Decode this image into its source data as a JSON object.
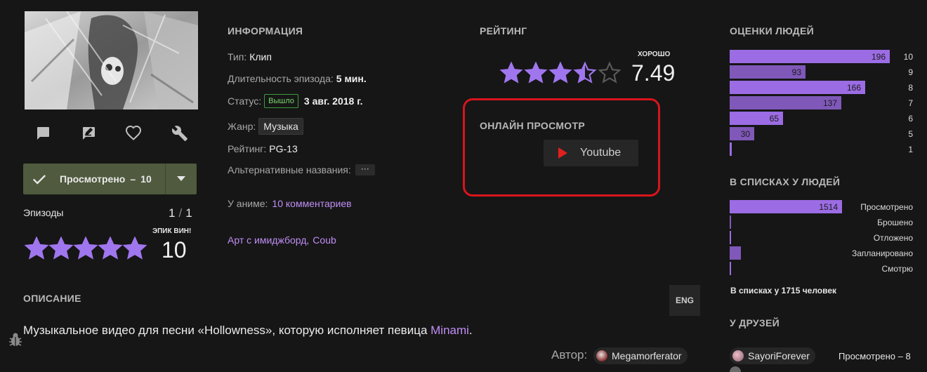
{
  "actions": {
    "comment_icon": "comment-icon",
    "review_icon": "review-icon",
    "favorite_icon": "heart-icon",
    "edit_icon": "wrench-icon"
  },
  "user_rate": {
    "status_label": "Просмотрено",
    "separator": "–",
    "score": "10",
    "episodes_label": "Эпизоды",
    "episodes_watched": "1",
    "episodes_sep": "/",
    "episodes_total": "1",
    "score_caption": "ЭПИК ВИН!",
    "score_big": "10",
    "stars": 5
  },
  "info": {
    "heading": "ИНФОРМАЦИЯ",
    "type_label": "Тип:",
    "type_value": "Клип",
    "duration_label": "Длительность эпизода:",
    "duration_value": "5 мин.",
    "status_label": "Статус:",
    "status_badge": "Вышло",
    "status_date": "3 авг. 2018 г.",
    "genre_label": "Жанр:",
    "genre_value": "Музыка",
    "rating_label": "Рейтинг:",
    "rating_value": "PG-13",
    "alt_names_label": "Альтернативные названия:",
    "alt_names_button": "···",
    "comments_label": "У аниме:",
    "comments_link": "10 комментариев",
    "link_art": "Арт с имиджборд",
    "link_sep": ",",
    "link_coub": "Coub"
  },
  "rating": {
    "heading": "РЕЙТИНГ",
    "caption": "ХОРОШО",
    "score": "7.49",
    "stars_value": 3.745,
    "stars_max": 5
  },
  "online": {
    "heading": "ОНЛАЙН ПРОСМОТР",
    "youtube_label": "Youtube"
  },
  "scores": {
    "heading": "ОЦЕНКИ ЛЮДЕЙ",
    "rows": [
      {
        "label": "10",
        "count": "196",
        "value": 196
      },
      {
        "label": "9",
        "count": "93",
        "value": 93
      },
      {
        "label": "8",
        "count": "166",
        "value": 166
      },
      {
        "label": "7",
        "count": "137",
        "value": 137
      },
      {
        "label": "6",
        "count": "65",
        "value": 65
      },
      {
        "label": "5",
        "count": "30",
        "value": 30
      },
      {
        "label": "1",
        "count": "",
        "value": 3
      }
    ],
    "max": 196
  },
  "lists": {
    "heading": "В СПИСКАХ У ЛЮДЕЙ",
    "rows": [
      {
        "label": "Просмотрено",
        "count": "1514",
        "value": 1514
      },
      {
        "label": "Брошено",
        "count": "",
        "value": 8
      },
      {
        "label": "Отложено",
        "count": "",
        "value": 4
      },
      {
        "label": "Запланировано",
        "count": "",
        "value": 150
      },
      {
        "label": "Смотрю",
        "count": "",
        "value": 4
      }
    ],
    "max": 1514,
    "total_caption": "В списках у 1715 человек"
  },
  "friends": {
    "heading": "У ДРУЗЕЙ",
    "friend_name": "SayoriForever",
    "friend_status": "Просмотрено – 8"
  },
  "description": {
    "heading": "ОПИСАНИЕ",
    "lang_button": "ENG",
    "text_prefix": "Музыкальное видео для песни «Hollowness», которую исполняет певица ",
    "text_link": "Minami",
    "text_suffix": ".",
    "author_label": "Автор:",
    "author_name": "Megamorferator"
  },
  "colors": {
    "background": "#161616",
    "accent": "#9b6ce3",
    "link": "#c08ef5",
    "watched_button": "#4f5a3e",
    "highlight_box": "#d9141c",
    "youtube_red": "#e01f1f"
  }
}
